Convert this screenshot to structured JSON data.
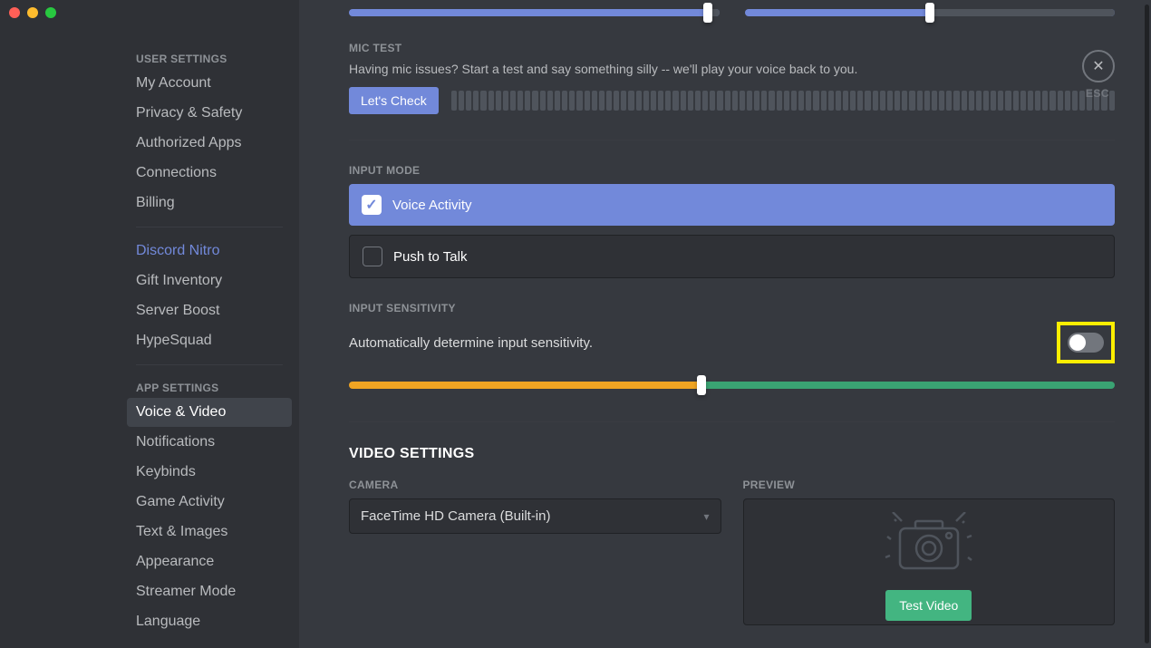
{
  "sidebar": {
    "heading_user": "USER SETTINGS",
    "heading_app": "APP SETTINGS",
    "items_user": [
      {
        "label": "My Account"
      },
      {
        "label": "Privacy & Safety"
      },
      {
        "label": "Authorized Apps"
      },
      {
        "label": "Connections"
      },
      {
        "label": "Billing"
      }
    ],
    "items_nitro": [
      {
        "label": "Discord Nitro",
        "nitro": true
      },
      {
        "label": "Gift Inventory"
      },
      {
        "label": "Server Boost"
      },
      {
        "label": "HypeSquad"
      }
    ],
    "items_app": [
      {
        "label": "Voice & Video",
        "active": true
      },
      {
        "label": "Notifications"
      },
      {
        "label": "Keybinds"
      },
      {
        "label": "Game Activity"
      },
      {
        "label": "Text & Images"
      },
      {
        "label": "Appearance"
      },
      {
        "label": "Streamer Mode"
      },
      {
        "label": "Language"
      }
    ]
  },
  "top_sliders": {
    "input_pct": 97,
    "output_pct": 50
  },
  "mic_test": {
    "heading": "MIC TEST",
    "desc": "Having mic issues? Start a test and say something silly -- we'll play your voice back to you.",
    "button": "Let's Check"
  },
  "input_mode": {
    "heading": "INPUT MODE",
    "option_voice": "Voice Activity",
    "option_ptt": "Push to Talk"
  },
  "input_sensitivity": {
    "heading": "INPUT SENSITIVITY",
    "toggle_label": "Automatically determine input sensitivity.",
    "toggle_on": false,
    "threshold_pct": 46
  },
  "video": {
    "heading": "VIDEO SETTINGS",
    "camera_label": "CAMERA",
    "camera_value": "FaceTime HD Camera (Built-in)",
    "preview_label": "PREVIEW",
    "test_button": "Test Video"
  },
  "close": {
    "esc": "ESC"
  }
}
